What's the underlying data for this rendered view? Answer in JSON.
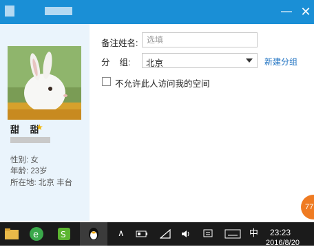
{
  "window": {
    "minimize_glyph": "—",
    "close_glyph": "✕"
  },
  "profile": {
    "nickname": "甜 甜",
    "star_glyph": "★",
    "gender": "性别: 女",
    "age": "年龄: 23岁",
    "location": "所在地: 北京  丰台"
  },
  "form": {
    "remark_label": "备注姓名:",
    "remark_placeholder": "选填",
    "group_label": "分    组:",
    "group_value": "北京",
    "new_group_link": "新建分组",
    "privacy_checkbox_label": "不允许此人访问我的空间",
    "privacy_checked": false
  },
  "float_badge": {
    "text": "77"
  },
  "taskbar": {
    "tray_arrow": "∧",
    "ime_label": "中",
    "time": "23:23",
    "date": "2016/8/20"
  },
  "colors": {
    "titlebar": "#1a8fd6",
    "accent_link": "#1a6fc0",
    "badge": "#ef7b22",
    "taskbar": "#1b1b1b"
  }
}
